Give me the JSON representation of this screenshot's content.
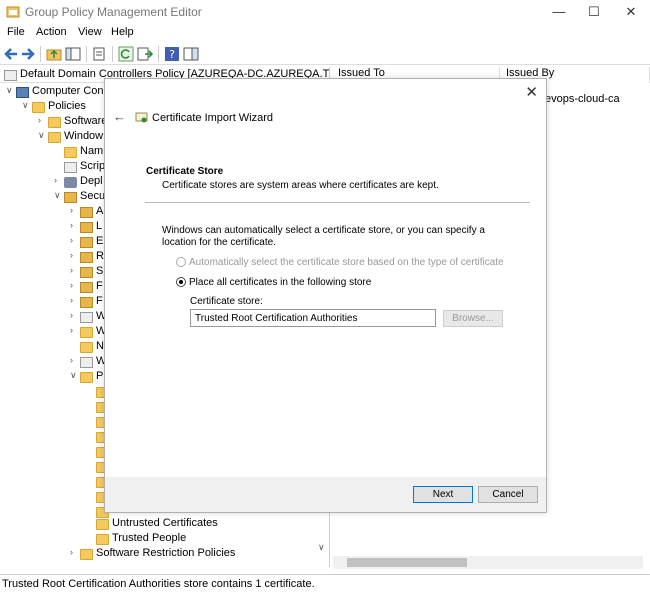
{
  "window": {
    "title": "Group Policy Management Editor",
    "minimize": "—",
    "maximize": "☐",
    "close": "✕"
  },
  "menu": [
    "File",
    "Action",
    "View",
    "Help"
  ],
  "tree": {
    "root": "Default Domain Controllers Policy [AZUREQA-DC.AZUREQA.TRIUJ.c",
    "nodes": [
      {
        "label": "Computer Con",
        "icon": "computer-icon"
      },
      {
        "label": "Policies",
        "icon": "folder-icon"
      },
      {
        "label": "Software",
        "icon": "folder-icon"
      },
      {
        "label": "Window",
        "icon": "folder-icon"
      },
      {
        "label": "Nam",
        "icon": "folder-icon"
      },
      {
        "label": "Scrip",
        "icon": "script-icon"
      },
      {
        "label": "Depl",
        "icon": "printer-icon"
      },
      {
        "label": "Secu",
        "icon": "security-icon"
      },
      {
        "label": "A",
        "icon": "folder-icon"
      },
      {
        "label": "L",
        "icon": "folder-icon"
      },
      {
        "label": "E",
        "icon": "folder-icon"
      },
      {
        "label": "R",
        "icon": "folder-icon"
      },
      {
        "label": "S",
        "icon": "folder-icon"
      },
      {
        "label": "F",
        "icon": "folder-icon"
      },
      {
        "label": "F",
        "icon": "folder-icon"
      },
      {
        "label": "W",
        "icon": "folder-icon"
      },
      {
        "label": "W",
        "icon": "folder-icon"
      },
      {
        "label": "N",
        "icon": "folder-icon"
      },
      {
        "label": "W",
        "icon": "folder-icon"
      },
      {
        "label": "P",
        "icon": "folder-icon"
      },
      {
        "label": "Untrusted Certificates",
        "icon": "folder-icon"
      },
      {
        "label": "Trusted People",
        "icon": "folder-icon"
      },
      {
        "label": "Software Restriction Policies",
        "icon": "folder-icon"
      }
    ]
  },
  "right_pane": {
    "columns": [
      "Issued To",
      "Issued By"
    ],
    "cell": "evops-cloud-ca"
  },
  "dialog": {
    "title": "Certificate Import Wizard",
    "section_title": "Certificate Store",
    "section_desc": "Certificate stores are system areas where certificates are kept.",
    "intro": "Windows can automatically select a certificate store, or you can specify a location for the certificate.",
    "option_auto": "Automatically select the certificate store based on the type of certificate",
    "option_place": "Place all certificates in the following store",
    "store_label": "Certificate store:",
    "store_value": "Trusted Root Certification Authorities",
    "browse": "Browse...",
    "next": "Next",
    "cancel": "Cancel"
  },
  "status": "Trusted Root Certification Authorities store contains 1 certificate."
}
